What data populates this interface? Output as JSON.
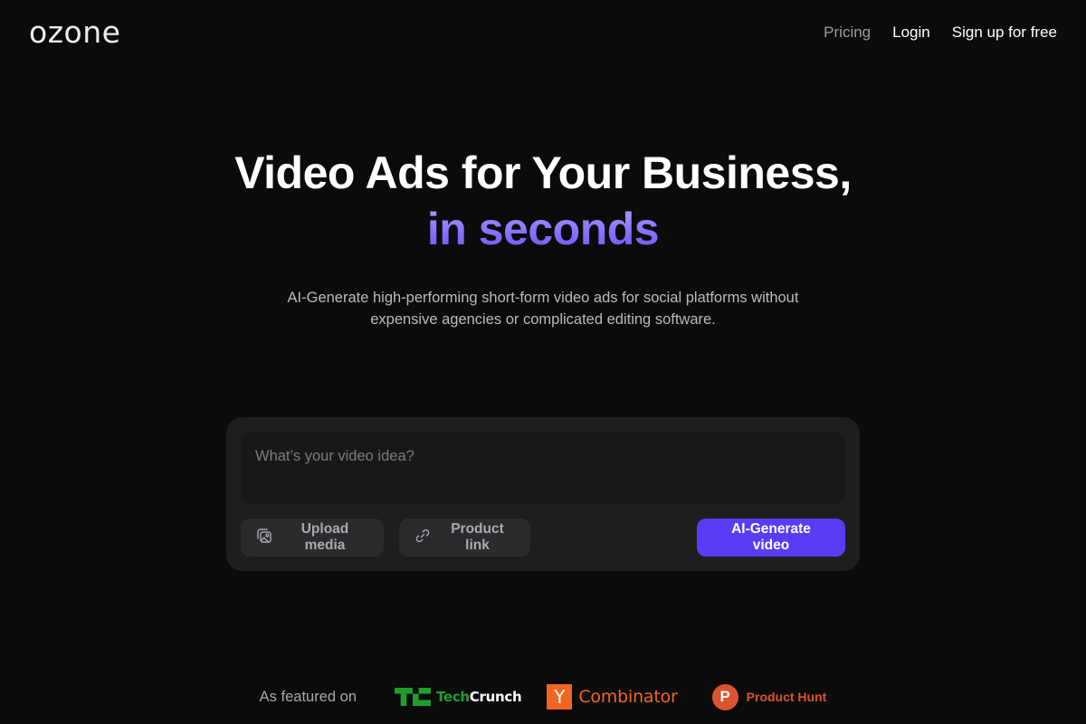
{
  "header": {
    "logo": "ozone",
    "nav": [
      {
        "label": "Pricing"
      },
      {
        "label": "Login"
      },
      {
        "label": "Sign up for free"
      }
    ]
  },
  "hero": {
    "title_line1": "Video Ads for Your Business,",
    "title_line2": "in seconds",
    "subtitle": "AI-Generate high-performing short-form video ads for social platforms without expensive agencies or complicated editing software."
  },
  "prompt_card": {
    "input_value": "",
    "input_placeholder": "What’s your video idea?",
    "upload_label": "Upload media",
    "upload_icon": "image-upload-icon",
    "link_label": "Product link",
    "link_icon": "link-icon",
    "generate_label": "AI-Generate video"
  },
  "featured": {
    "label": "As featured on",
    "logos": [
      {
        "name": "TechCrunch",
        "part1": "Tech",
        "part2": "Crunch",
        "icon": "techcrunch-logo-icon"
      },
      {
        "name": "Y Combinator",
        "mark": "Y",
        "text": "Combinator",
        "icon": "ycombinator-logo-icon"
      },
      {
        "name": "Product Hunt",
        "mark": "P",
        "text": "Product Hunt",
        "icon": "producthunt-logo-icon"
      }
    ]
  },
  "colors": {
    "background": "#0b0b0c",
    "accent": "#5a3cf6",
    "gradient_top": "#aea3ff",
    "gradient_bottom": "#6a4df0",
    "card": "#1e1e1f",
    "techcrunch_green": "#1f9e2d",
    "yc_orange": "#f26522",
    "producthunt_orange": "#da552f"
  }
}
